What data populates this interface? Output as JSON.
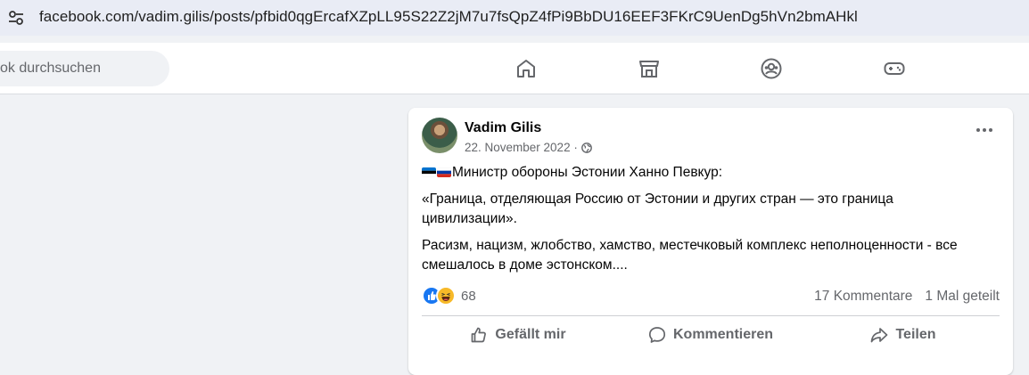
{
  "browser": {
    "url": "facebook.com/vadim.gilis/posts/pfbid0qgErcafXZpLL95S22Z2jM7u7fsQpZ4fPi9BbDU16EEF3FKrC9UenDg5hVn2bmAHkl",
    "site_info_icon": "tune-icon"
  },
  "nav": {
    "search_placeholder": "ok durchsuchen",
    "icons": [
      "home-icon",
      "marketplace-icon",
      "groups-icon",
      "gaming-icon"
    ]
  },
  "post": {
    "author": "Vadim Gilis",
    "date": "22. November 2022 ·",
    "audience_icon": "globe-icon",
    "paragraphs": [
      "Министр обороны Эстонии Ханно Певкур:",
      "«Граница, отделяющая Россию от Эстонии и других стран — это граница цивилизации».",
      "Расизм, нацизм, жлобство, хамство, местечковый комплекс неполноценности - все смешалось в доме эстонском...."
    ],
    "flags": [
      "estonia-flag",
      "russia-flag"
    ],
    "reaction_count": "68",
    "comments": "17 Kommentare",
    "shares": "1 Mal geteilt",
    "actions": {
      "like": "Gefällt mir",
      "comment": "Kommentieren",
      "share": "Teilen"
    }
  },
  "colors": {
    "like_blue": "#1877f2",
    "haha_yellow": "#f7b928",
    "secondary_text": "#65676b",
    "page_bg": "#f0f2f5"
  }
}
